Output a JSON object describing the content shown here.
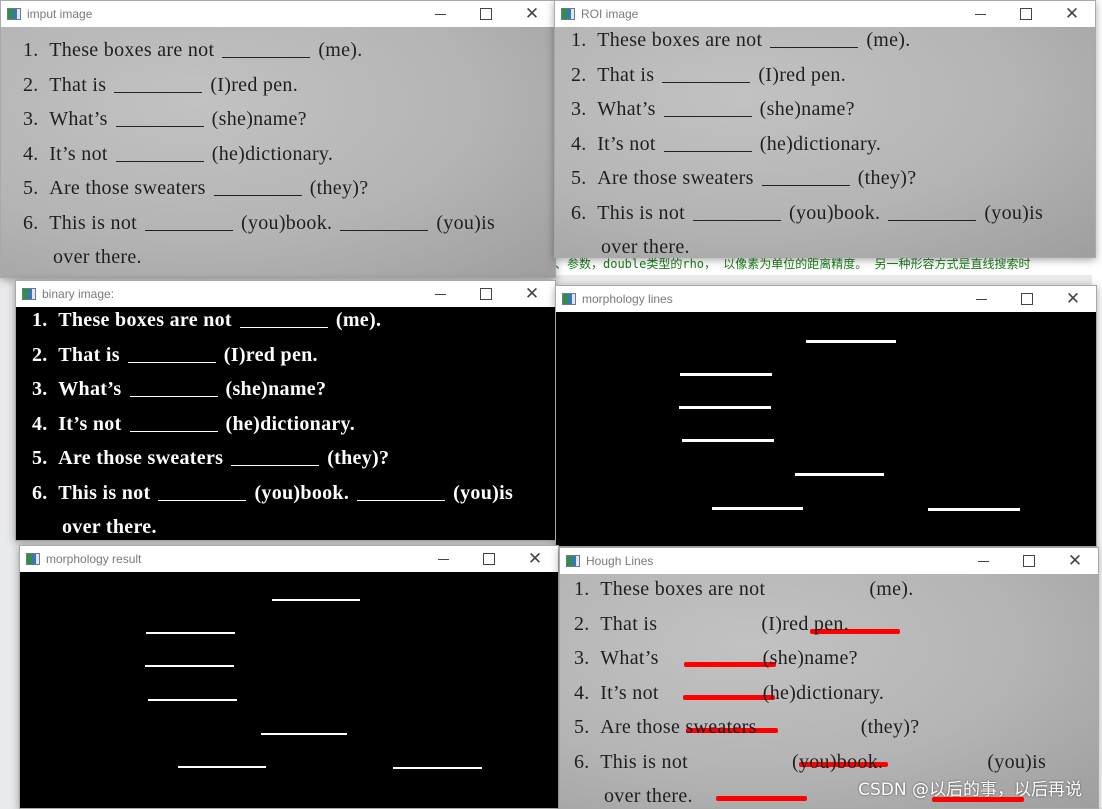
{
  "background": {
    "editor_text": "、参数，double类型的rho， 以像素为单位的距离精度。 另一种形容方式是直线搜索时"
  },
  "windows": {
    "input": {
      "title": "imput image",
      "icon": "opencv-window-icon"
    },
    "roi": {
      "title": "ROI image",
      "icon": "opencv-window-icon"
    },
    "binary": {
      "title": "binary image:",
      "icon": "opencv-window-icon"
    },
    "morph_lines": {
      "title": "morphology lines",
      "icon": "opencv-window-icon"
    },
    "morph_result": {
      "title": "morphology result",
      "icon": "opencv-window-icon"
    },
    "hough": {
      "title": "Hough Lines",
      "icon": "opencv-window-icon"
    }
  },
  "controls": {
    "minimize": "minimize-icon",
    "maximize": "maximize-icon",
    "close": "close-icon"
  },
  "worksheet": {
    "lines": [
      {
        "num": "1.",
        "before": "These boxes are not",
        "after": "(me)."
      },
      {
        "num": "2.",
        "before": "That is",
        "after": "(I)red pen."
      },
      {
        "num": "3.",
        "before": "What’s",
        "after": "(she)name?"
      },
      {
        "num": "4.",
        "before": "It’s not",
        "after": "(he)dictionary."
      },
      {
        "num": "5.",
        "before": "Are those sweaters",
        "after": "(they)?"
      },
      {
        "num": "6.",
        "before": "This is not",
        "after": "(you)book.",
        "after2": "(you)is"
      },
      {
        "num": "",
        "before": "over there.",
        "after": ""
      }
    ]
  },
  "detected_lines_count": 7,
  "watermark": "CSDN @以后的事，以后再说"
}
